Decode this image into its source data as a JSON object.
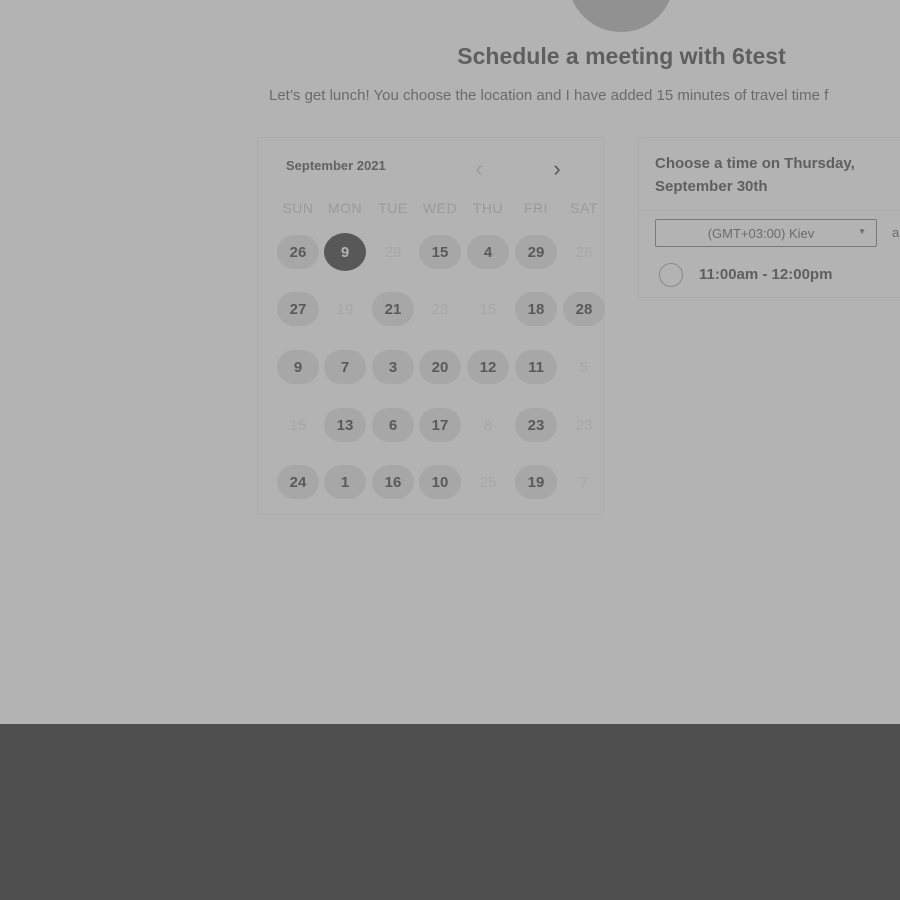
{
  "header": {
    "title": "Schedule a meeting with 6test",
    "subtitle": "Let’s get lunch! You choose the location and I have added 15 minutes of travel time f"
  },
  "calendar": {
    "month_label": "September 2021",
    "prev_icon": "chevron-left-icon",
    "next_icon": "chevron-right-icon",
    "weekdays": [
      "SUN",
      "MON",
      "TUE",
      "WED",
      "THU",
      "FRI",
      "SAT"
    ],
    "selected_day": "9",
    "rows": [
      [
        {
          "d": "26",
          "a": true
        },
        {
          "d": "9",
          "a": true,
          "s": true
        },
        {
          "d": "29",
          "a": false
        },
        {
          "d": "15",
          "a": true
        },
        {
          "d": "4",
          "a": true
        },
        {
          "d": "29",
          "a": true
        },
        {
          "d": "26",
          "a": false
        }
      ],
      [
        {
          "d": "27",
          "a": true
        },
        {
          "d": "19",
          "a": false
        },
        {
          "d": "21",
          "a": true
        },
        {
          "d": "28",
          "a": false
        },
        {
          "d": "15",
          "a": false
        },
        {
          "d": "18",
          "a": true
        },
        {
          "d": "28",
          "a": true
        }
      ],
      [
        {
          "d": "9",
          "a": true
        },
        {
          "d": "7",
          "a": true
        },
        {
          "d": "3",
          "a": true
        },
        {
          "d": "20",
          "a": true
        },
        {
          "d": "12",
          "a": true
        },
        {
          "d": "11",
          "a": true
        },
        {
          "d": "5",
          "a": false
        }
      ],
      [
        {
          "d": "15",
          "a": false
        },
        {
          "d": "13",
          "a": true
        },
        {
          "d": "6",
          "a": true
        },
        {
          "d": "17",
          "a": true
        },
        {
          "d": "8",
          "a": false
        },
        {
          "d": "23",
          "a": true
        },
        {
          "d": "23",
          "a": false
        }
      ],
      [
        {
          "d": "24",
          "a": true
        },
        {
          "d": "1",
          "a": true
        },
        {
          "d": "16",
          "a": true
        },
        {
          "d": "10",
          "a": true
        },
        {
          "d": "25",
          "a": false
        },
        {
          "d": "19",
          "a": true
        },
        {
          "d": "7",
          "a": false
        }
      ]
    ]
  },
  "time_panel": {
    "title": "Choose a time on Thursday, September 30th",
    "timezone": "(GMT+03:00) Kiev",
    "timezone_icon": "caret-down-icon",
    "extra": "a",
    "slots": [
      {
        "label": "11:00am - 12:00pm",
        "selected": false
      }
    ]
  },
  "colors": {
    "overlay_bg": "#b3b3b3",
    "bottom_band": "#4f4f4f",
    "selected_day_bg": "#585858",
    "available_day_bg": "#a7a7a7"
  }
}
